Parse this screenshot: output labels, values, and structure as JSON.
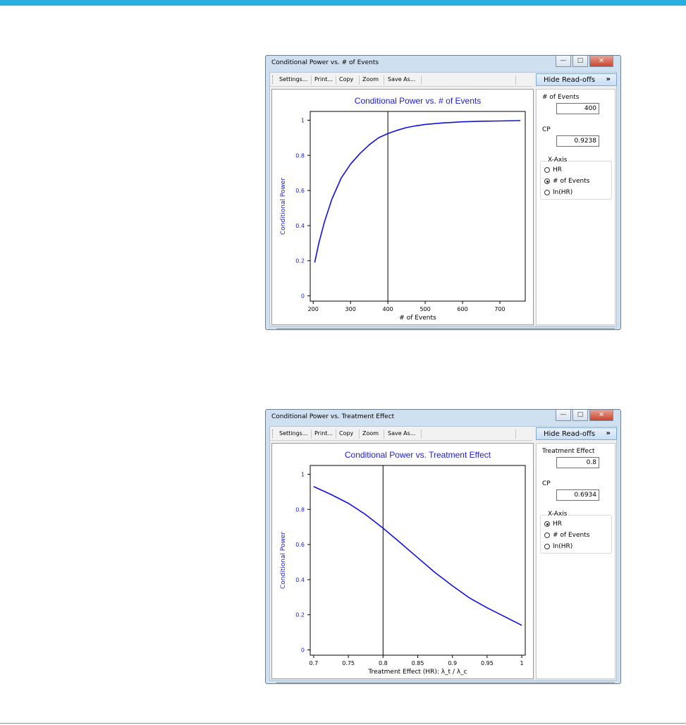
{
  "windows": [
    {
      "title": "Conditional Power vs. # of Events",
      "toolbar": {
        "settings": "Settings...",
        "print": "Print...",
        "copy": "Copy",
        "zoom": "Zoom",
        "save_as": "Save As..."
      },
      "hide_readoffs_label": "Hide Read-offs",
      "hide_readoffs_arrow": "»",
      "readoff": {
        "field_label": "# of Events",
        "field_value": "400",
        "cp_label": "CP",
        "cp_value": "0.9238"
      },
      "xaxis_group": {
        "title": "X-Axis",
        "options": [
          {
            "label": "HR",
            "selected": false
          },
          {
            "label": "# of Events",
            "selected": true
          },
          {
            "label": "ln(HR)",
            "selected": false
          }
        ]
      }
    },
    {
      "title": "Conditional Power vs. Treatment Effect",
      "toolbar": {
        "settings": "Settings...",
        "print": "Print...",
        "copy": "Copy",
        "zoom": "Zoom",
        "save_as": "Save As..."
      },
      "hide_readoffs_label": "Hide Read-offs",
      "hide_readoffs_arrow": "»",
      "readoff": {
        "field_label": "Treatment Effect",
        "field_value": "0.8",
        "cp_label": "CP",
        "cp_value": "0.6934"
      },
      "xaxis_group": {
        "title": "X-Axis",
        "options": [
          {
            "label": "HR",
            "selected": true
          },
          {
            "label": "# of Events",
            "selected": false
          },
          {
            "label": "ln(HR)",
            "selected": false
          }
        ]
      }
    }
  ],
  "chart_data": [
    {
      "type": "line",
      "title": "Conditional Power vs. # of Events",
      "xlabel": "# of Events",
      "ylabel": "Conditional Power",
      "xlim": [
        192,
        768
      ],
      "ylim": [
        -0.03,
        1.05
      ],
      "xticks": [
        200,
        300,
        400,
        500,
        600,
        700
      ],
      "yticks": [
        0,
        0.2,
        0.4,
        0.6,
        0.8,
        1
      ],
      "ytick_labels": [
        "0",
        "0.2",
        "0.4",
        "0.6",
        "0.8",
        "1"
      ],
      "reference_x": 400,
      "line_color": "#1010e0",
      "series": [
        {
          "x": [
            204,
            215,
            230,
            250,
            275,
            300,
            325,
            350,
            375,
            400,
            425,
            450,
            475,
            500,
            550,
            600,
            650,
            700,
            755
          ],
          "y": [
            0.19,
            0.3,
            0.42,
            0.55,
            0.67,
            0.75,
            0.81,
            0.86,
            0.9,
            0.924,
            0.943,
            0.958,
            0.968,
            0.976,
            0.985,
            0.991,
            0.994,
            0.996,
            0.998
          ]
        }
      ]
    },
    {
      "type": "line",
      "title": "Conditional Power vs. Treatment Effect",
      "xlabel": "Treatment Effect (HR): λ_t / λ_c",
      "ylabel": "Conditional Power",
      "xlim": [
        0.695,
        1.005
      ],
      "ylim": [
        -0.03,
        1.05
      ],
      "xticks": [
        0.7,
        0.75,
        0.8,
        0.85,
        0.9,
        0.95,
        1
      ],
      "xtick_labels": [
        "0.7",
        "0.75",
        "0.8",
        "0.85",
        "0.9",
        "0.95",
        "1"
      ],
      "yticks": [
        0,
        0.2,
        0.4,
        0.6,
        0.8,
        1
      ],
      "ytick_labels": [
        "0",
        "0.2",
        "0.4",
        "0.6",
        "0.8",
        "1"
      ],
      "reference_x": 0.8,
      "line_color": "#1010e0",
      "series": [
        {
          "x": [
            0.7,
            0.725,
            0.75,
            0.775,
            0.8,
            0.825,
            0.85,
            0.875,
            0.9,
            0.925,
            0.95,
            0.975,
            1.0
          ],
          "y": [
            0.93,
            0.885,
            0.835,
            0.77,
            0.693,
            0.61,
            0.525,
            0.44,
            0.365,
            0.295,
            0.24,
            0.19,
            0.14
          ]
        }
      ]
    }
  ]
}
